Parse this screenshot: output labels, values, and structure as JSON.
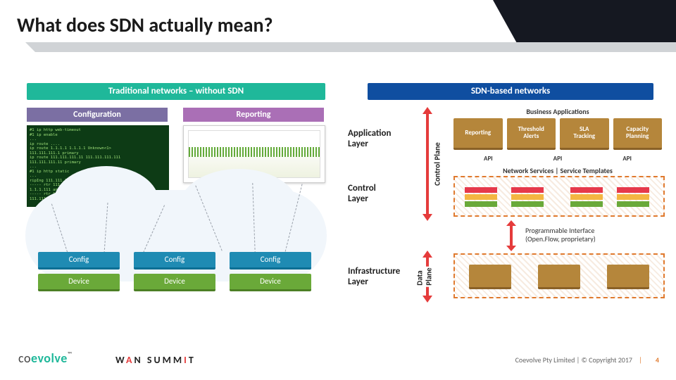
{
  "title": "What does SDN actually mean?",
  "banners": {
    "traditional": "Traditional networks – without SDN",
    "sdn": "SDN-based networks"
  },
  "sub": {
    "configuration": "Configuration",
    "reporting": "Reporting"
  },
  "terminal_text": "#1 ip http web-timeout\n#1 ip enable\n...\nip route ....\nip route 1.1.1.1 1.1.1.1 Unknown<1>\n111.111.111.1 primary\nip route 111.111.111.11 111.111.111.111\n111.111.111.11 primary\n...\n#1 ip http static\n...\nripIng 111.111.111.1\n----- rtr 111 icmp - ip 111.111.111.1\n1.1.1.111 any\n----- rtr 111 icmp - ip from\n111.111.111.111 any",
  "devices": {
    "config_label": "Config",
    "device_label": "Device"
  },
  "sdn_layers": {
    "application": "Application\nLayer",
    "control": "Control\nLayer",
    "infrastructure": "Infrastructure\nLayer"
  },
  "planes": {
    "control": "Control Plane",
    "data": "Data\nPlane"
  },
  "business": {
    "heading": "Business Applications",
    "apps": [
      "Reporting",
      "Threshold\nAlerts",
      "SLA\nTracking",
      "Capacity\nPlanning"
    ]
  },
  "api_label": "API",
  "network_services": "Network Services | Service Templates",
  "programmable_interface": "Programmable Interface\n(Open.Flow, proprietary)",
  "footer": {
    "logo1_a": "co",
    "logo1_b": "evolve",
    "logo1_tm": "™",
    "logo2_a": "W",
    "logo2_b": "N SUMM",
    "logo2_c": "T",
    "copyright": "Coevolve Pty Limited | © Copyright 2017",
    "pipe": "|",
    "page": "4"
  }
}
